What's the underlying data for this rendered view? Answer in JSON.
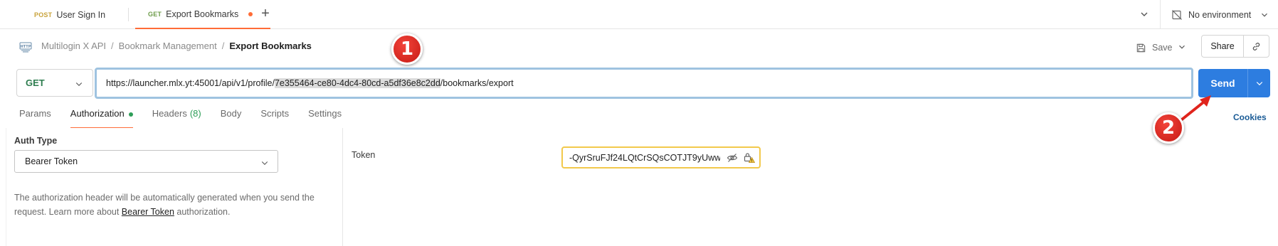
{
  "tabs": [
    {
      "method": "POST",
      "label": "User Sign In"
    },
    {
      "method": "GET",
      "label": "Export Bookmarks"
    }
  ],
  "environment": {
    "label": "No environment"
  },
  "breadcrumb": {
    "items": [
      "Multilogin X API",
      "Bookmark Management"
    ],
    "current": "Export Bookmarks",
    "separator": "/"
  },
  "toolbar": {
    "save_label": "Save",
    "share_label": "Share"
  },
  "request": {
    "method": "GET",
    "url_prefix": "https://launcher.mlx.yt:45001/api/v1/profile/",
    "url_highlight": "7e355464-ce80-4dc4-80cd-a5df36e8c2dd",
    "url_suffix": "/bookmarks/export",
    "send_label": "Send"
  },
  "request_tabs": {
    "params": "Params",
    "authorization": "Authorization",
    "headers": "Headers",
    "headers_count": "(8)",
    "body": "Body",
    "scripts": "Scripts",
    "settings": "Settings",
    "cookies": "Cookies"
  },
  "auth": {
    "type_label": "Auth Type",
    "type_value": "Bearer Token",
    "desc_1": "The authorization header will be automatically generated when you send the request. Learn more about ",
    "desc_link": "Bearer Token",
    "desc_2": " authorization.",
    "token_label": "Token",
    "token_value": "-QyrSruFJf24LQtCrSQsCOTJT9yUww"
  },
  "annotations": {
    "step1": "1",
    "step2": "2"
  },
  "colors": {
    "accent_orange": "#ff6c37",
    "send_blue": "#2d7de0",
    "get_green": "#2e7d4f",
    "warning_yellow": "#f2c94c",
    "annotation_red": "#d8231c"
  },
  "icons": {
    "http": "http-icon",
    "environment": "no-environment-icon",
    "save": "save-icon",
    "link": "link-icon",
    "eye": "eye-off-icon",
    "lock_warning": "lock-warning-icon"
  }
}
